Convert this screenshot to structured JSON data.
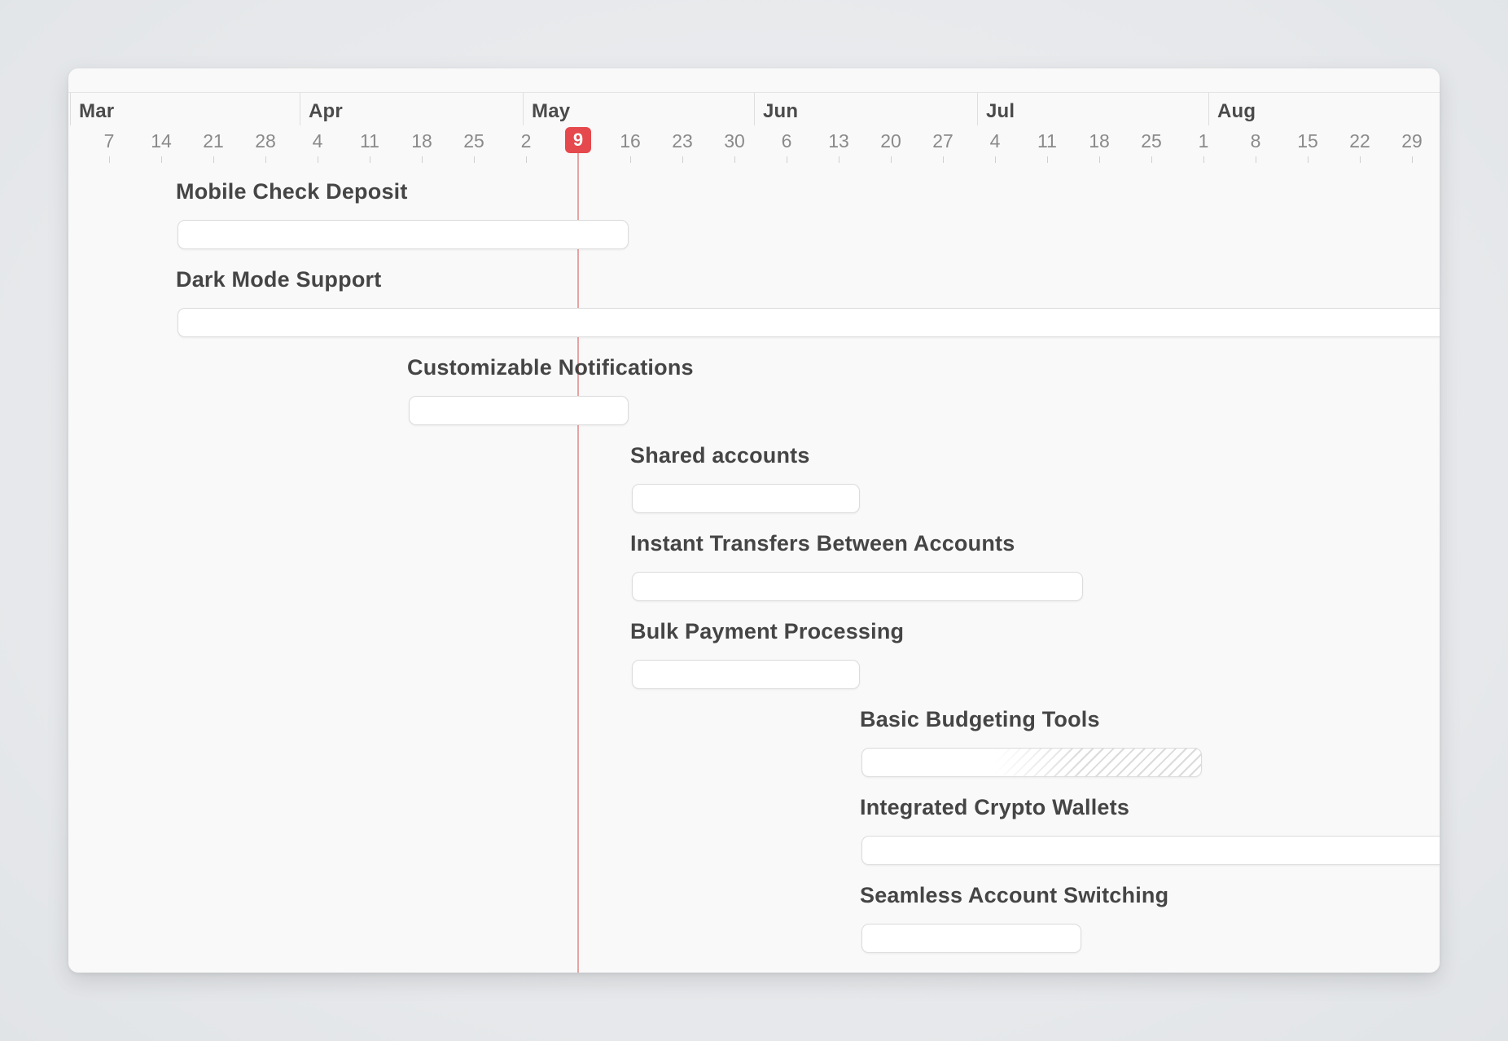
{
  "timeline": {
    "months": [
      "Mar",
      "Apr",
      "May",
      "Jun",
      "Jul",
      "Aug"
    ],
    "days": [
      "7",
      "14",
      "21",
      "28",
      "4",
      "11",
      "18",
      "25",
      "2",
      "9",
      "16",
      "23",
      "30",
      "6",
      "13",
      "20",
      "27",
      "4",
      "11",
      "18",
      "25",
      "1",
      "8",
      "15",
      "22",
      "29"
    ],
    "today_label": "9",
    "today_color": "#e5484d"
  },
  "tasks": [
    {
      "title": "Mobile Check Deposit",
      "style": "normal"
    },
    {
      "title": "Dark Mode Support",
      "style": "continues-right"
    },
    {
      "title": "Customizable Notifications",
      "style": "normal"
    },
    {
      "title": "Shared accounts",
      "style": "normal"
    },
    {
      "title": "Instant Transfers Between Accounts",
      "style": "normal"
    },
    {
      "title": "Bulk Payment Processing",
      "style": "normal"
    },
    {
      "title": "Basic Budgeting Tools",
      "style": "hatched-end"
    },
    {
      "title": "Integrated Crypto Wallets",
      "style": "continues-right"
    },
    {
      "title": "Seamless Account Switching",
      "style": "normal"
    }
  ]
}
